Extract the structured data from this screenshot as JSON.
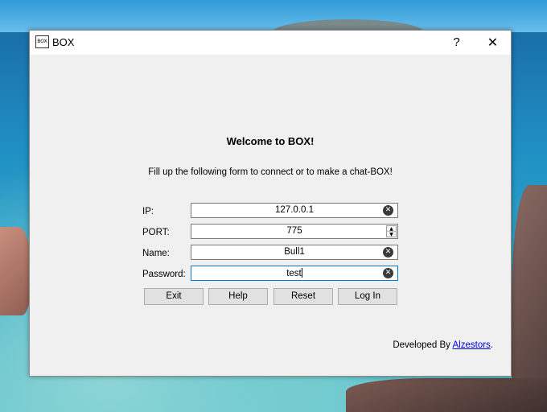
{
  "window": {
    "title": "BOX",
    "icon_text": "BOX",
    "help_label": "?",
    "close_label": "✕"
  },
  "form": {
    "welcome": "Welcome to BOX!",
    "subtitle": "Fill up the following form to connect or to make a chat-BOX!",
    "fields": {
      "ip": {
        "label": "IP:",
        "value": "127.0.0.1"
      },
      "port": {
        "label": "PORT:",
        "value": "775"
      },
      "name": {
        "label": "Name:",
        "value": "Bull1"
      },
      "password": {
        "label": "Password:",
        "value": "test"
      }
    },
    "buttons": {
      "exit": "Exit",
      "help": "Help",
      "reset": "Reset",
      "login": "Log In"
    }
  },
  "footer": {
    "prefix": "Developed By ",
    "author": "Alzestors",
    "suffix": "."
  },
  "icons": {
    "clear": "clear-icon",
    "spin_up": "chevron-up-icon",
    "spin_down": "chevron-down-icon"
  },
  "colors": {
    "focus_border": "#0078d7",
    "link": "#0000ee",
    "window_bg": "#f0f0f0"
  }
}
